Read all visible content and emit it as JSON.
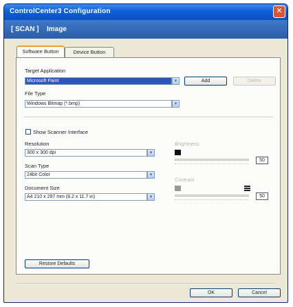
{
  "window": {
    "title": "ControlCenter3 Configuration",
    "close_glyph": "✕"
  },
  "banner": {
    "scan": "[ SCAN ]",
    "image": "Image"
  },
  "tabs": [
    {
      "label": "Software Button"
    },
    {
      "label": "Device Button"
    }
  ],
  "target_application": {
    "label": "Target Application",
    "value": "Microsoft Paint",
    "add_label": "Add",
    "delete_label": "Delete"
  },
  "file_type": {
    "label": "File Type",
    "value": "Windows Bitmap (*.bmp)"
  },
  "show_scanner": {
    "label": "Show Scanner Interface",
    "checked": false
  },
  "resolution": {
    "label": "Resolution",
    "value": "300 x 300 dpi"
  },
  "scan_type": {
    "label": "Scan Type",
    "value": "24bit Color"
  },
  "document_size": {
    "label": "Document Size",
    "value": "A4 210 x 297 mm (8.2 x 11.7 in)"
  },
  "brightness": {
    "label": "Brightness",
    "value": "50"
  },
  "contrast": {
    "label": "Contrast",
    "value": "50"
  },
  "restore_label": "Restore Defaults",
  "ok_label": "OK",
  "cancel_label": "Cancel",
  "dropdown_glyph": "▾",
  "colors": {
    "title_blue": "#0d5fd8",
    "banner_blue": "#3f79c8",
    "selection": "#2a56b8"
  }
}
